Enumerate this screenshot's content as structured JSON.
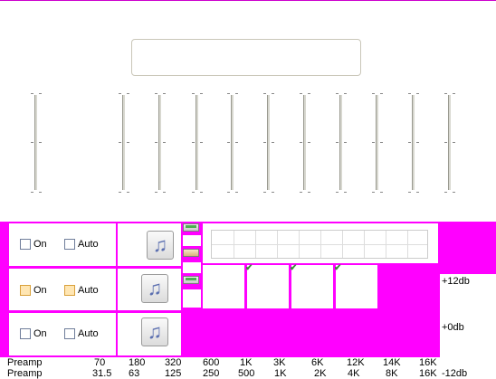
{
  "rows": [
    {
      "on_label": "On",
      "auto_label": "Auto",
      "highlight": false
    },
    {
      "on_label": "On",
      "auto_label": "Auto",
      "highlight": true
    },
    {
      "on_label": "On",
      "auto_label": "Auto",
      "highlight": false
    }
  ],
  "music_icon": "music-note-icon",
  "db_scale": {
    "top": "+12db",
    "mid": "+0db",
    "bottom": "-12db"
  },
  "freq_row_1": {
    "label": "Preamp",
    "values": [
      "70",
      "180",
      "320",
      "600",
      "1K",
      "3K",
      "6K",
      "12K",
      "14K",
      "16K"
    ]
  },
  "freq_row_2": {
    "label": "Preamp",
    "values": [
      "31.5",
      "63",
      "125",
      "250",
      "500",
      "1K",
      "2K",
      "4K",
      "8K",
      "16K"
    ]
  },
  "colors": {
    "accent": "#ff00ff",
    "check": "#3a8a3a"
  }
}
